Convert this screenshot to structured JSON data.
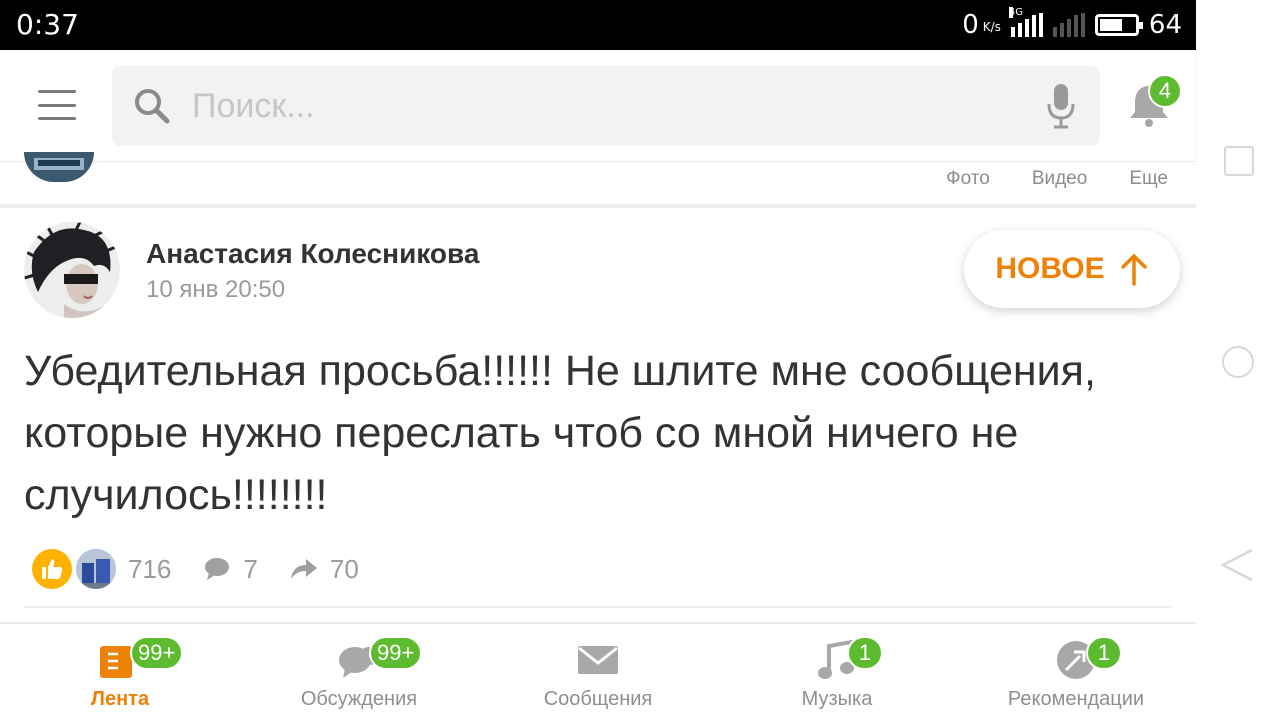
{
  "status_bar": {
    "time": "0:37",
    "net_speed": "0",
    "net_unit": "K/s",
    "net_type": "4G",
    "battery": "64"
  },
  "header": {
    "search_placeholder": "Поиск...",
    "notifications_badge": "4"
  },
  "prev_post": {
    "links": [
      "Фото",
      "Видео",
      "Еще"
    ]
  },
  "post": {
    "author": "Анастасия Колесникова",
    "date": "10 янв 20:50",
    "new_button": "НОВОЕ",
    "text": "Убедительная просьба!!!!!! Не шлите мне сообщения, которые нужно переслать чтоб со мной ничего не случилось!!!!!!!!",
    "likes": "716",
    "comments": "7",
    "shares": "70"
  },
  "bottom_nav": {
    "tabs": [
      {
        "label": "Лента",
        "badge": "99+",
        "icon": "feed-icon"
      },
      {
        "label": "Обсуждения",
        "badge": "99+",
        "icon": "discussions-icon"
      },
      {
        "label": "Сообщения",
        "badge": "",
        "icon": "messages-icon"
      },
      {
        "label": "Музыка",
        "badge": "1",
        "icon": "music-icon"
      },
      {
        "label": "Рекомендации",
        "badge": "1",
        "icon": "recommendations-icon"
      }
    ]
  },
  "colors": {
    "accent": "#ee8208",
    "badge": "#5dbb2f",
    "icon_gray": "#b0b0b0"
  }
}
